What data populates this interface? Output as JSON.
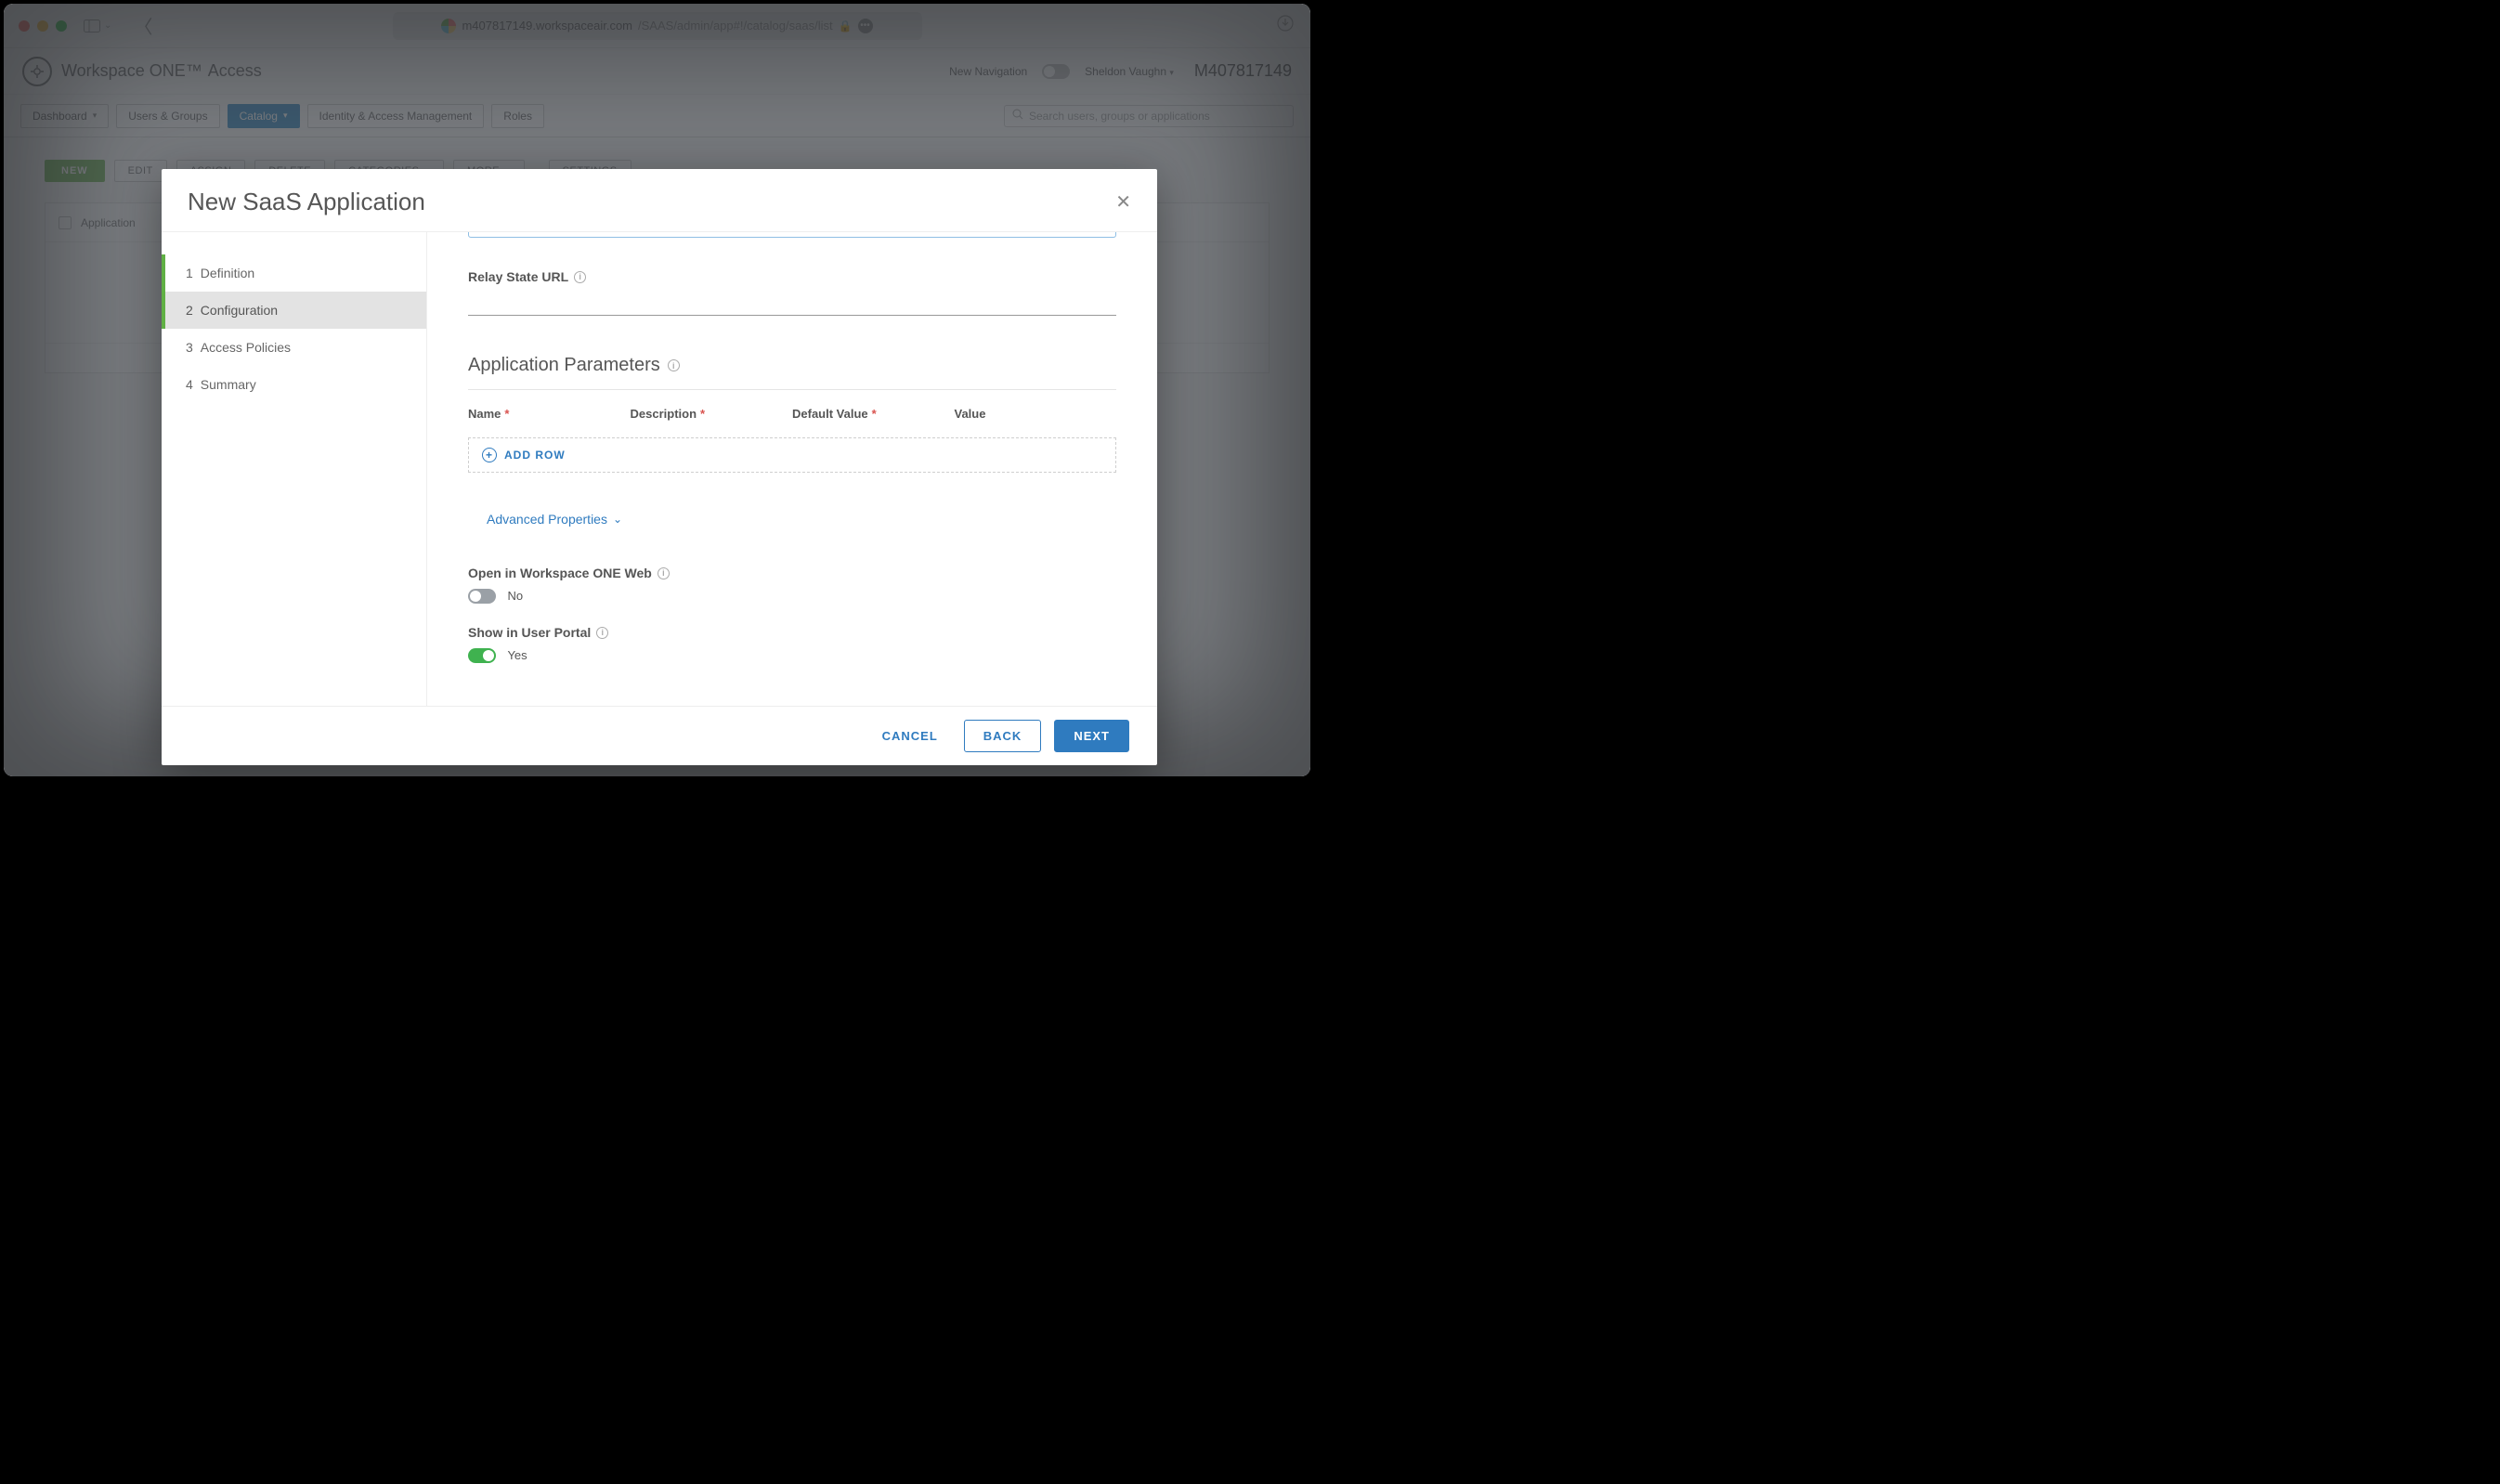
{
  "browser": {
    "url_host": "m407817149.workspaceair.com",
    "url_path": "/SAAS/admin/app#!/catalog/saas/list"
  },
  "header": {
    "brand_primary": "Workspace ONE™",
    "brand_secondary": "Access",
    "new_nav_label": "New Navigation",
    "user_name": "Sheldon Vaughn",
    "tenant_id": "M407817149"
  },
  "nav": {
    "dashboard": "Dashboard",
    "users_groups": "Users & Groups",
    "catalog": "Catalog",
    "iam": "Identity & Access Management",
    "roles": "Roles",
    "search_placeholder": "Search users, groups or applications"
  },
  "toolbar": {
    "new": "NEW",
    "edit": "EDIT",
    "assign": "ASSIGN",
    "delete": "DELETE",
    "categories": "CATEGORIES",
    "more": "MORE",
    "settings": "SETTINGS"
  },
  "grid": {
    "col_application": "Application"
  },
  "modal": {
    "title": "New SaaS Application",
    "steps": {
      "s1_num": "1",
      "s1_label": "Definition",
      "s2_num": "2",
      "s2_label": "Configuration",
      "s3_num": "3",
      "s3_label": "Access Policies",
      "s4_num": "4",
      "s4_label": "Summary"
    },
    "relay_label": "Relay State URL",
    "section_params": "Application Parameters",
    "cols": {
      "name": "Name",
      "desc": "Description",
      "default": "Default Value",
      "value": "Value"
    },
    "add_row": "ADD ROW",
    "advanced": "Advanced Properties",
    "open_ws1": "Open in Workspace ONE Web",
    "open_ws1_val": "No",
    "show_portal": "Show in User Portal",
    "show_portal_val": "Yes",
    "btn_cancel": "CANCEL",
    "btn_back": "BACK",
    "btn_next": "NEXT"
  }
}
